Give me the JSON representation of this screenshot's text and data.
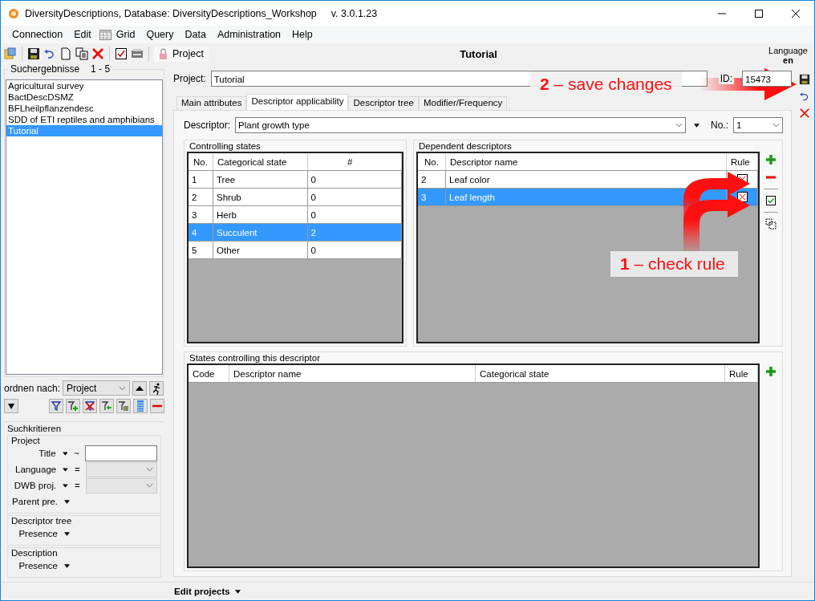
{
  "window": {
    "title": "DiversityDescriptions,  Database: DiversityDescriptions_Workshop",
    "version": "v. 3.0.1.23"
  },
  "menu": [
    {
      "label": "Connection"
    },
    {
      "label": "Edit"
    },
    {
      "label": "Grid",
      "icon": true
    },
    {
      "label": "Query"
    },
    {
      "label": "Data"
    },
    {
      "label": "Administration"
    },
    {
      "label": "Help"
    }
  ],
  "toolbar": {
    "project_button": "Project"
  },
  "header": {
    "title": "Tutorial",
    "language_label": "Language",
    "language": "en"
  },
  "results": {
    "label": "Suchergebnisse",
    "range": "1 - 5",
    "items": [
      {
        "label": "Agricultural survey",
        "selected": false
      },
      {
        "label": "BactDescDSMZ",
        "selected": false
      },
      {
        "label": "BFLheilpflanzendesc",
        "selected": false
      },
      {
        "label": "SDD of ETI reptiles and amphibians",
        "selected": false
      },
      {
        "label": "Tutorial",
        "selected": true
      }
    ]
  },
  "sort": {
    "label": "ordnen nach:",
    "value": "Project"
  },
  "search_criteria": {
    "title": "Suchkritieren",
    "groups": [
      {
        "title": "Project",
        "fields": [
          {
            "label": "Title",
            "operator": "~",
            "kind": "text"
          },
          {
            "label": "Language",
            "operator": "=",
            "kind": "dropdown"
          },
          {
            "label": "DWB proj.",
            "operator": "=",
            "kind": "dropdown"
          },
          {
            "label": "Parent pre.",
            "kind": "none"
          }
        ]
      },
      {
        "title": "Descriptor tree",
        "fields": [
          {
            "label": "Presence",
            "kind": "none"
          }
        ]
      },
      {
        "title": "Description",
        "fields": [
          {
            "label": "Presence",
            "kind": "none"
          }
        ]
      }
    ]
  },
  "project": {
    "label": "Project:",
    "value": "Tutorial",
    "id_label": "ID:",
    "id": "15473"
  },
  "tabs": [
    {
      "label": "Main attributes",
      "selected": false
    },
    {
      "label": "Descriptor applicability",
      "selected": true
    },
    {
      "label": "Descriptor tree",
      "selected": false
    },
    {
      "label": "Modifier/Frequency",
      "selected": false
    }
  ],
  "descriptor": {
    "label": "Descriptor:",
    "value": "Plant growth type",
    "no_label": "No.:",
    "no": "1"
  },
  "controlling_states": {
    "title": "Controlling states",
    "columns": [
      "No.",
      "Categorical state",
      "#"
    ],
    "rows": [
      {
        "no": "1",
        "state": "Tree",
        "count": "0",
        "selected": false
      },
      {
        "no": "2",
        "state": "Shrub",
        "count": "0",
        "selected": false
      },
      {
        "no": "3",
        "state": "Herb",
        "count": "0",
        "selected": false
      },
      {
        "no": "4",
        "state": "Succulent",
        "count": "2",
        "selected": true
      },
      {
        "no": "5",
        "state": "Other",
        "count": "0",
        "selected": false
      }
    ]
  },
  "dependent_descriptors": {
    "title": "Dependent descriptors",
    "columns": [
      "No.",
      "Descriptor name",
      "Rule"
    ],
    "rows": [
      {
        "no": "2",
        "name": "Leaf color",
        "rule": false,
        "selected": false
      },
      {
        "no": "3",
        "name": "Leaf length",
        "rule": false,
        "selected": true
      }
    ]
  },
  "states_controlling": {
    "title": "States controlling this descriptor",
    "columns": [
      "Code",
      "Descriptor name",
      "Categorical state",
      "Rule"
    ]
  },
  "callouts": [
    {
      "text": "**2** – save changes"
    },
    {
      "text": "**1** – check rule"
    }
  ],
  "status_bar": {
    "label": "Edit projects"
  }
}
